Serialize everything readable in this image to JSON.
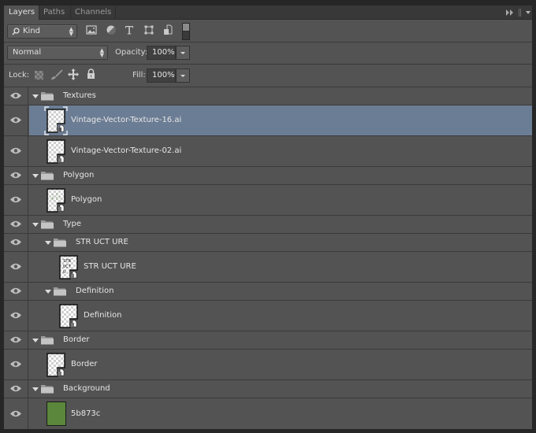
{
  "tabs": [
    {
      "label": "Layers",
      "active": true
    },
    {
      "label": "Paths",
      "active": false
    },
    {
      "label": "Channels",
      "active": false
    }
  ],
  "panel_menu": {
    "collapse_icon": "double-arrow-right-icon",
    "menu_icon": "panel-menu-icon"
  },
  "filter": {
    "kind_label": "Kind",
    "search_icon": "search-icon",
    "filter_icons": [
      "pixel-layer-filter-icon",
      "adjustment-layer-filter-icon",
      "type-layer-filter-icon",
      "shape-layer-filter-icon",
      "smart-object-filter-icon",
      "filter-toggle-icon"
    ]
  },
  "blend": {
    "mode": "Normal",
    "opacity_label": "Opacity:",
    "opacity_value": "100%"
  },
  "lock": {
    "label": "Lock:",
    "icons": [
      "lock-transparent-pixels-icon",
      "lock-image-pixels-icon",
      "lock-position-icon",
      "lock-all-icon"
    ],
    "fill_label": "Fill:",
    "fill_value": "100%"
  },
  "layers": [
    {
      "name": "Textures",
      "type": "group",
      "indent": 0,
      "visible": true,
      "expanded": true
    },
    {
      "name": "Vintage-Vector-Texture-16.ai",
      "type": "smart",
      "indent": 0,
      "visible": true,
      "selected": true
    },
    {
      "name": "Vintage-Vector-Texture-02.ai",
      "type": "smart",
      "indent": 0,
      "visible": true
    },
    {
      "name": "Polygon",
      "type": "group",
      "indent": 0,
      "visible": true,
      "expanded": true
    },
    {
      "name": "Polygon",
      "type": "smart",
      "indent": 0,
      "visible": true,
      "thumb": "polygon"
    },
    {
      "name": "Type",
      "type": "group",
      "indent": 0,
      "visible": true,
      "expanded": true
    },
    {
      "name": "STR UCT URE",
      "type": "group",
      "indent": 1,
      "visible": true,
      "expanded": true
    },
    {
      "name": "STR UCT URE",
      "type": "smart",
      "indent": 1,
      "visible": true,
      "thumb": "text"
    },
    {
      "name": "Definition",
      "type": "group",
      "indent": 1,
      "visible": true,
      "expanded": true
    },
    {
      "name": "Definition",
      "type": "smart",
      "indent": 1,
      "visible": true
    },
    {
      "name": "Border",
      "type": "group",
      "indent": 0,
      "visible": true,
      "expanded": true
    },
    {
      "name": "Border",
      "type": "smart",
      "indent": 0,
      "visible": true
    },
    {
      "name": "Background",
      "type": "group",
      "indent": 0,
      "visible": true,
      "expanded": true
    },
    {
      "name": "5b873c",
      "type": "fill",
      "indent": 0,
      "visible": true,
      "color": "#5b873c"
    }
  ],
  "colors": {
    "panel_bg": "#535353",
    "selected_row": "#6b7d94",
    "fill_swatch": "#5b873c"
  }
}
